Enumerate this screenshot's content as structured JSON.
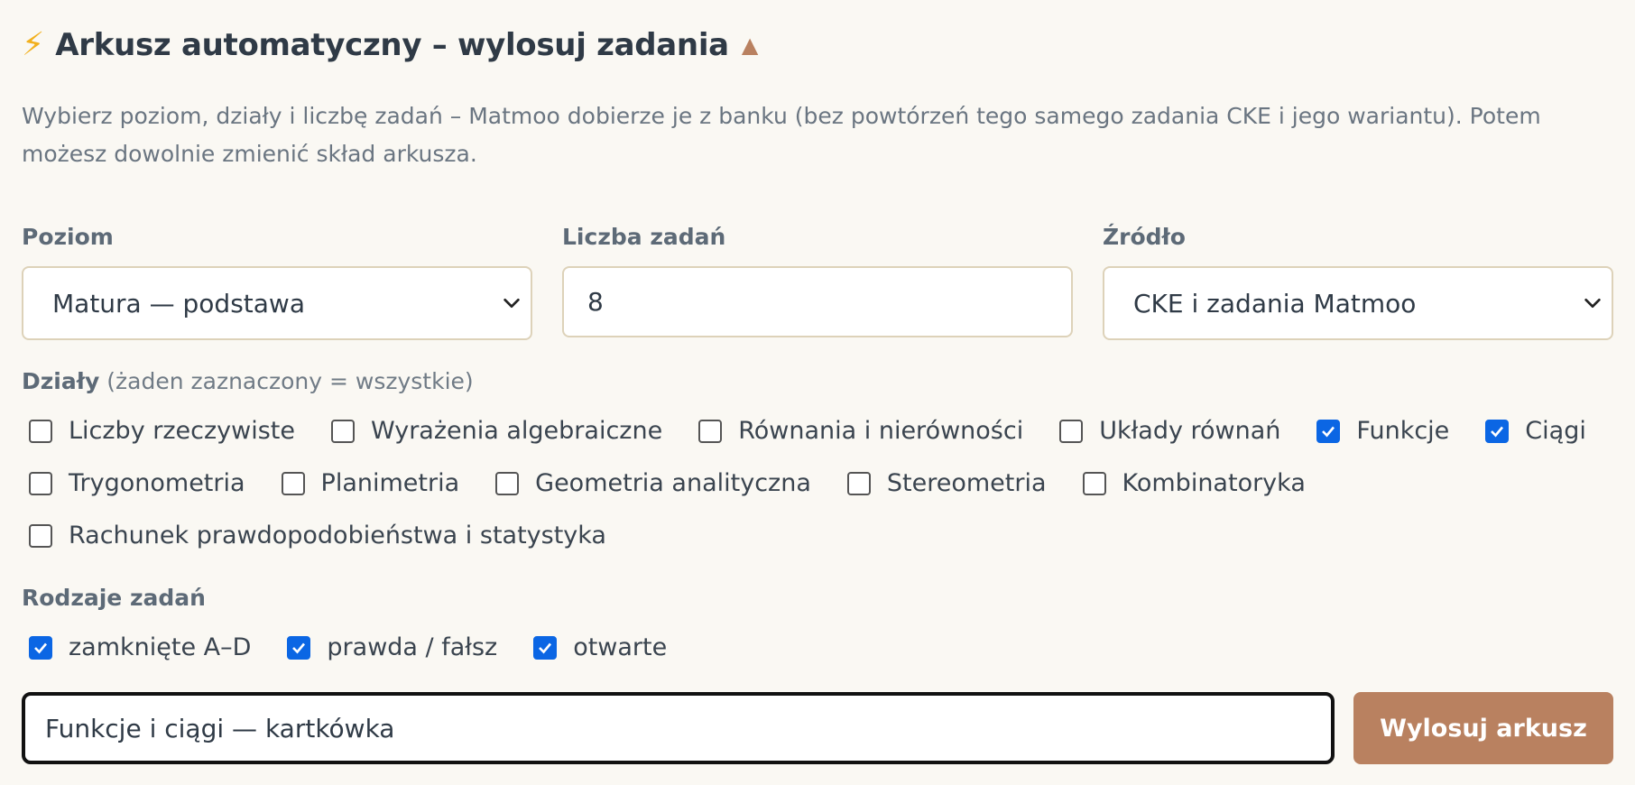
{
  "header": {
    "icon": "lightning-icon",
    "title": "Arkusz automatyczny – wylosuj zadania",
    "caret_icon": "triangle-up-icon"
  },
  "description": "Wybierz poziom, działy i liczbę zadań – Matmoo dobierze je z banku (bez powtórzeń tego samego zadania CKE i jego wariantu). Potem możesz dowolnie zmienić skład arkusza.",
  "level": {
    "label": "Poziom",
    "value": "Matura — podstawa"
  },
  "count": {
    "label": "Liczba zadań",
    "value": "8"
  },
  "source": {
    "label": "Źródło",
    "value": "CKE i zadania Matmoo"
  },
  "topics": {
    "label": "Działy",
    "hint": "(żaden zaznaczony = wszystkie)",
    "rows": [
      [
        {
          "label": "Liczby rzeczywiste",
          "checked": false
        },
        {
          "label": "Wyrażenia algebraiczne",
          "checked": false
        },
        {
          "label": "Równania i nierówności",
          "checked": false
        },
        {
          "label": "Układy równań",
          "checked": false
        },
        {
          "label": "Funkcje",
          "checked": true
        },
        {
          "label": "Ciągi",
          "checked": true
        }
      ],
      [
        {
          "label": "Trygonometria",
          "checked": false
        },
        {
          "label": "Planimetria",
          "checked": false
        },
        {
          "label": "Geometria analityczna",
          "checked": false
        },
        {
          "label": "Stereometria",
          "checked": false
        },
        {
          "label": "Kombinatoryka",
          "checked": false
        }
      ],
      [
        {
          "label": "Rachunek prawdopodobieństwa i statystyka",
          "checked": false
        }
      ]
    ]
  },
  "task_types": {
    "label": "Rodzaje zadań",
    "items": [
      {
        "label": "zamknięte A–D",
        "checked": true
      },
      {
        "label": "prawda / fałsz",
        "checked": true
      },
      {
        "label": "otwarte",
        "checked": true
      }
    ]
  },
  "sheet_name": {
    "value": "Funkcje i ciągi — kartkówka"
  },
  "draw_button": {
    "label": "Wylosuj arkusz"
  },
  "colors": {
    "accent": "#b98160",
    "checkbox_checked": "#0b66e4",
    "background": "#faf8f3"
  }
}
